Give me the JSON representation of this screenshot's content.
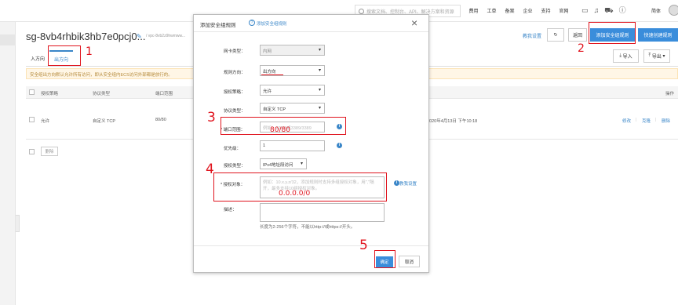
{
  "topnav": {
    "search_placeholder": "搜索文档、控制台、API、解决方案和资源",
    "links": [
      "费用",
      "工单",
      "备案",
      "企业",
      "支持",
      "官网"
    ],
    "icons": [
      "terminal-icon",
      "bell-icon",
      "cart-icon",
      "help-icon"
    ],
    "user_label": "简体"
  },
  "page": {
    "title": "sg-8vb4rhbik3hb7e0pcj0...",
    "subtitle": "/ vpc-8vb2z9hwmww...",
    "teach_link": "教我设置",
    "back_label": "返回",
    "add_rule_label": "添加安全组规则",
    "quick_add_label": "快速创建规则",
    "import_label": "导入",
    "export_label": "导出"
  },
  "tabs": [
    {
      "label": "入方向",
      "active": false
    },
    {
      "label": "出方向",
      "active": true
    }
  ],
  "notice": "安全组出方向默认允许所有访问，即从安全组内ECS访问外部都是放行的。",
  "table": {
    "headers": [
      "授权策略",
      "协议类型",
      "端口范围",
      "操作"
    ],
    "row": {
      "policy": "允许",
      "protocol": "自定义 TCP",
      "port": "80/80",
      "created": "2020年4月13日 下午10:18",
      "actions": [
        "修改",
        "克隆",
        "删除"
      ]
    },
    "delete_label": "删除"
  },
  "modal": {
    "title": "添加安全组规则",
    "help_label": "添加安全组规则",
    "nic_label": "网卡类型：",
    "nic_value": "内网",
    "direction_label": "规则方向：",
    "direction_value": "出方向",
    "policy_label": "授权策略：",
    "policy_value": "允许",
    "protocol_label": "协议类型：",
    "protocol_value": "自定义 TCP",
    "port_label": "* 端口范围：",
    "port_placeholder": "例如：22/22或3389/3389",
    "priority_label": "优先级：",
    "priority_value": "1",
    "authtype_label": "授权类型：",
    "authtype_value": "IPv4地址段访问",
    "authobj_label": "* 授权对象：",
    "authobj_placeholder": "例如：10.x.y.z/32，添加规则时支持多组授权对象，用\",\"隔开，最多支持10组授权对象。",
    "teach_link": "教我设置",
    "desc_label": "描述：",
    "desc_hint": "长度为2-256个字符，不能以http://或https://开头。",
    "ok_label": "确定",
    "cancel_label": "取消"
  },
  "annotations": {
    "step1": "1",
    "step2": "2",
    "step3": "3",
    "step4": "4",
    "step5": "5",
    "port_value": "80/80",
    "authobj_value": "0.0.0.0/0",
    "color": "#e0141e"
  },
  "colors": {
    "primary": "#3a8ddb",
    "link": "#3a86c8",
    "notice_bg": "#fff6e6"
  }
}
